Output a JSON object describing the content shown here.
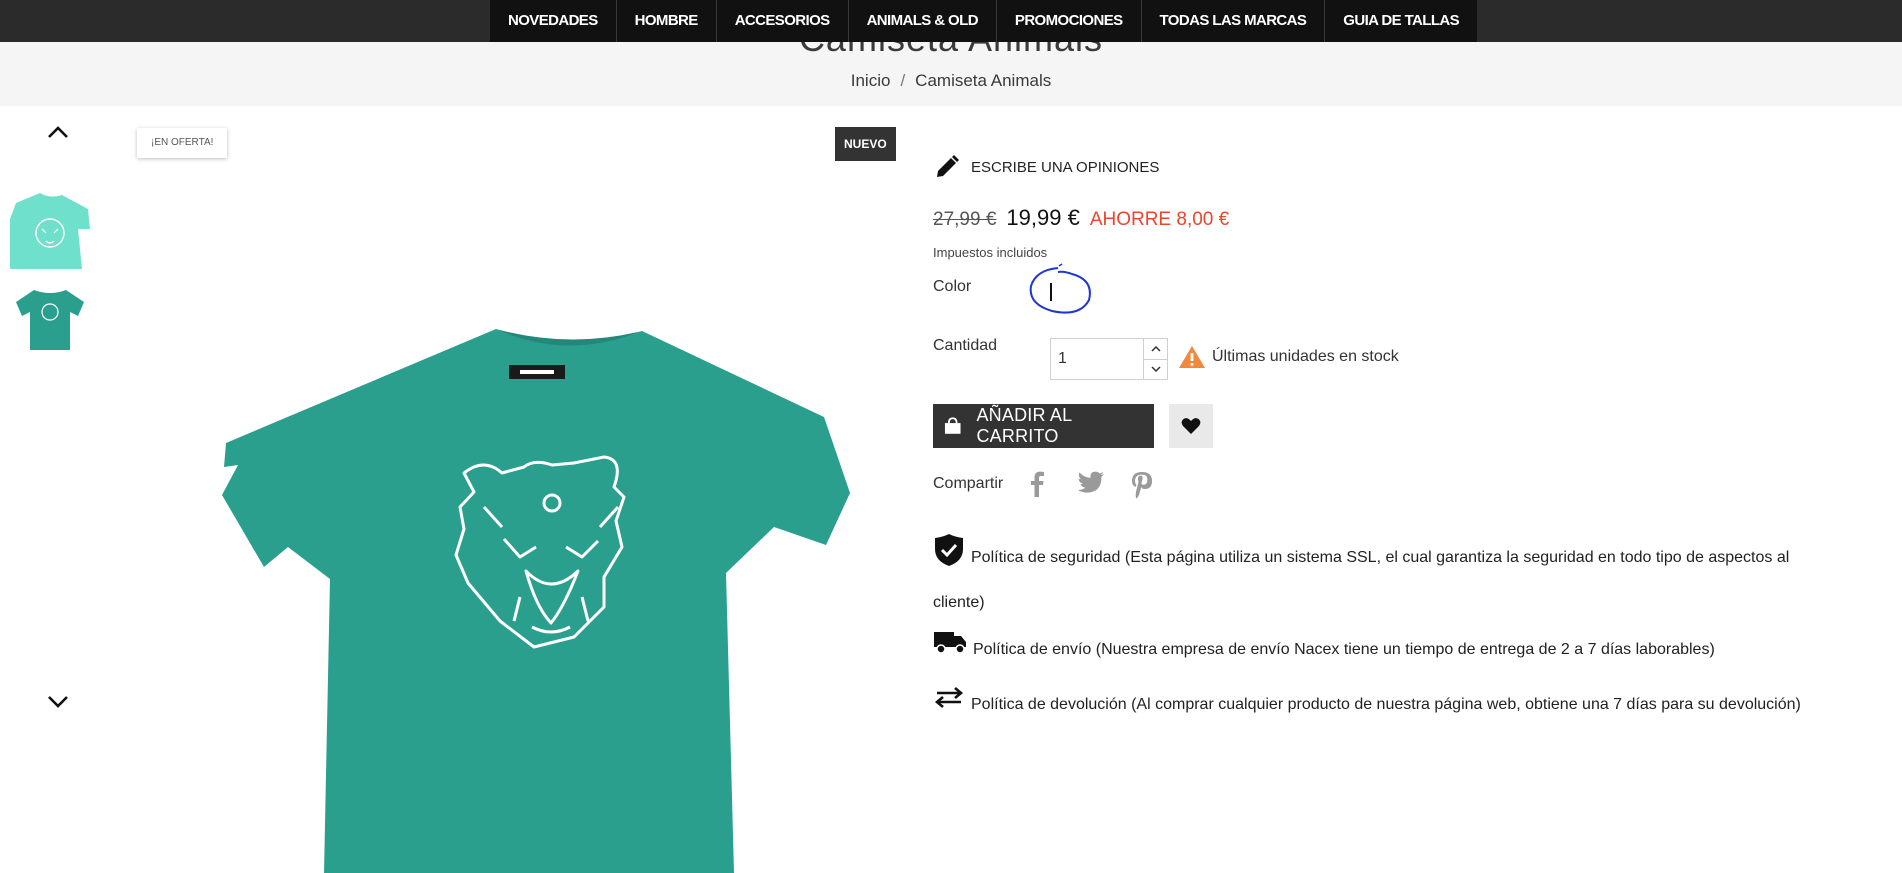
{
  "nav": {
    "items": [
      "NOVEDADES",
      "HOMBRE",
      "ACCESORIOS",
      "ANIMALS & OLD",
      "PROMOCIONES",
      "TODAS LAS MARCAS",
      "GUIA DE TALLAS"
    ]
  },
  "header": {
    "title": "Camiseta Animals",
    "breadcrumb": [
      "Inicio",
      "Camiseta Animals"
    ]
  },
  "gallery": {
    "badge_sale": "¡EN OFERTA!",
    "badge_new": "NUEVO",
    "shirt_color": "#2a9f8e",
    "thumb1_color": "#6fe0cb",
    "icons": [
      "chevron-up-icon",
      "chevron-down-icon"
    ]
  },
  "product": {
    "review_label": "ESCRIBE UNA OPINIONES",
    "old_price": "27,99 €",
    "price": "19,99 €",
    "save": "AHORRE 8,00 €",
    "tax_note": "Impuestos incluidos",
    "color_label": "Color",
    "quantity_label": "Cantidad",
    "quantity_value": "1",
    "stock_message": "Últimas unidades en stock",
    "add_to_cart": "AÑADIR AL CARRITO",
    "share_label": "Compartir",
    "share_icons": [
      "facebook-icon",
      "twitter-icon",
      "pinterest-icon"
    ],
    "accent_color": "#e8472b",
    "warning_color": "#f0883e"
  },
  "policies": [
    {
      "icon": "shield-check-icon",
      "text": "Política de seguridad (Esta página utiliza un sistema SSL, el cual garantiza la seguridad en todo tipo de aspectos al cliente)"
    },
    {
      "icon": "truck-icon",
      "text": "Política de envío (Nuestra empresa de envío Nacex tiene un tiempo de entrega de 2 a 7 días laborables)"
    },
    {
      "icon": "swap-arrows-icon",
      "text": "Política de devolución (Al comprar cualquier producto de nuestra página web, obtiene una 7 días para su devolución)"
    }
  ]
}
